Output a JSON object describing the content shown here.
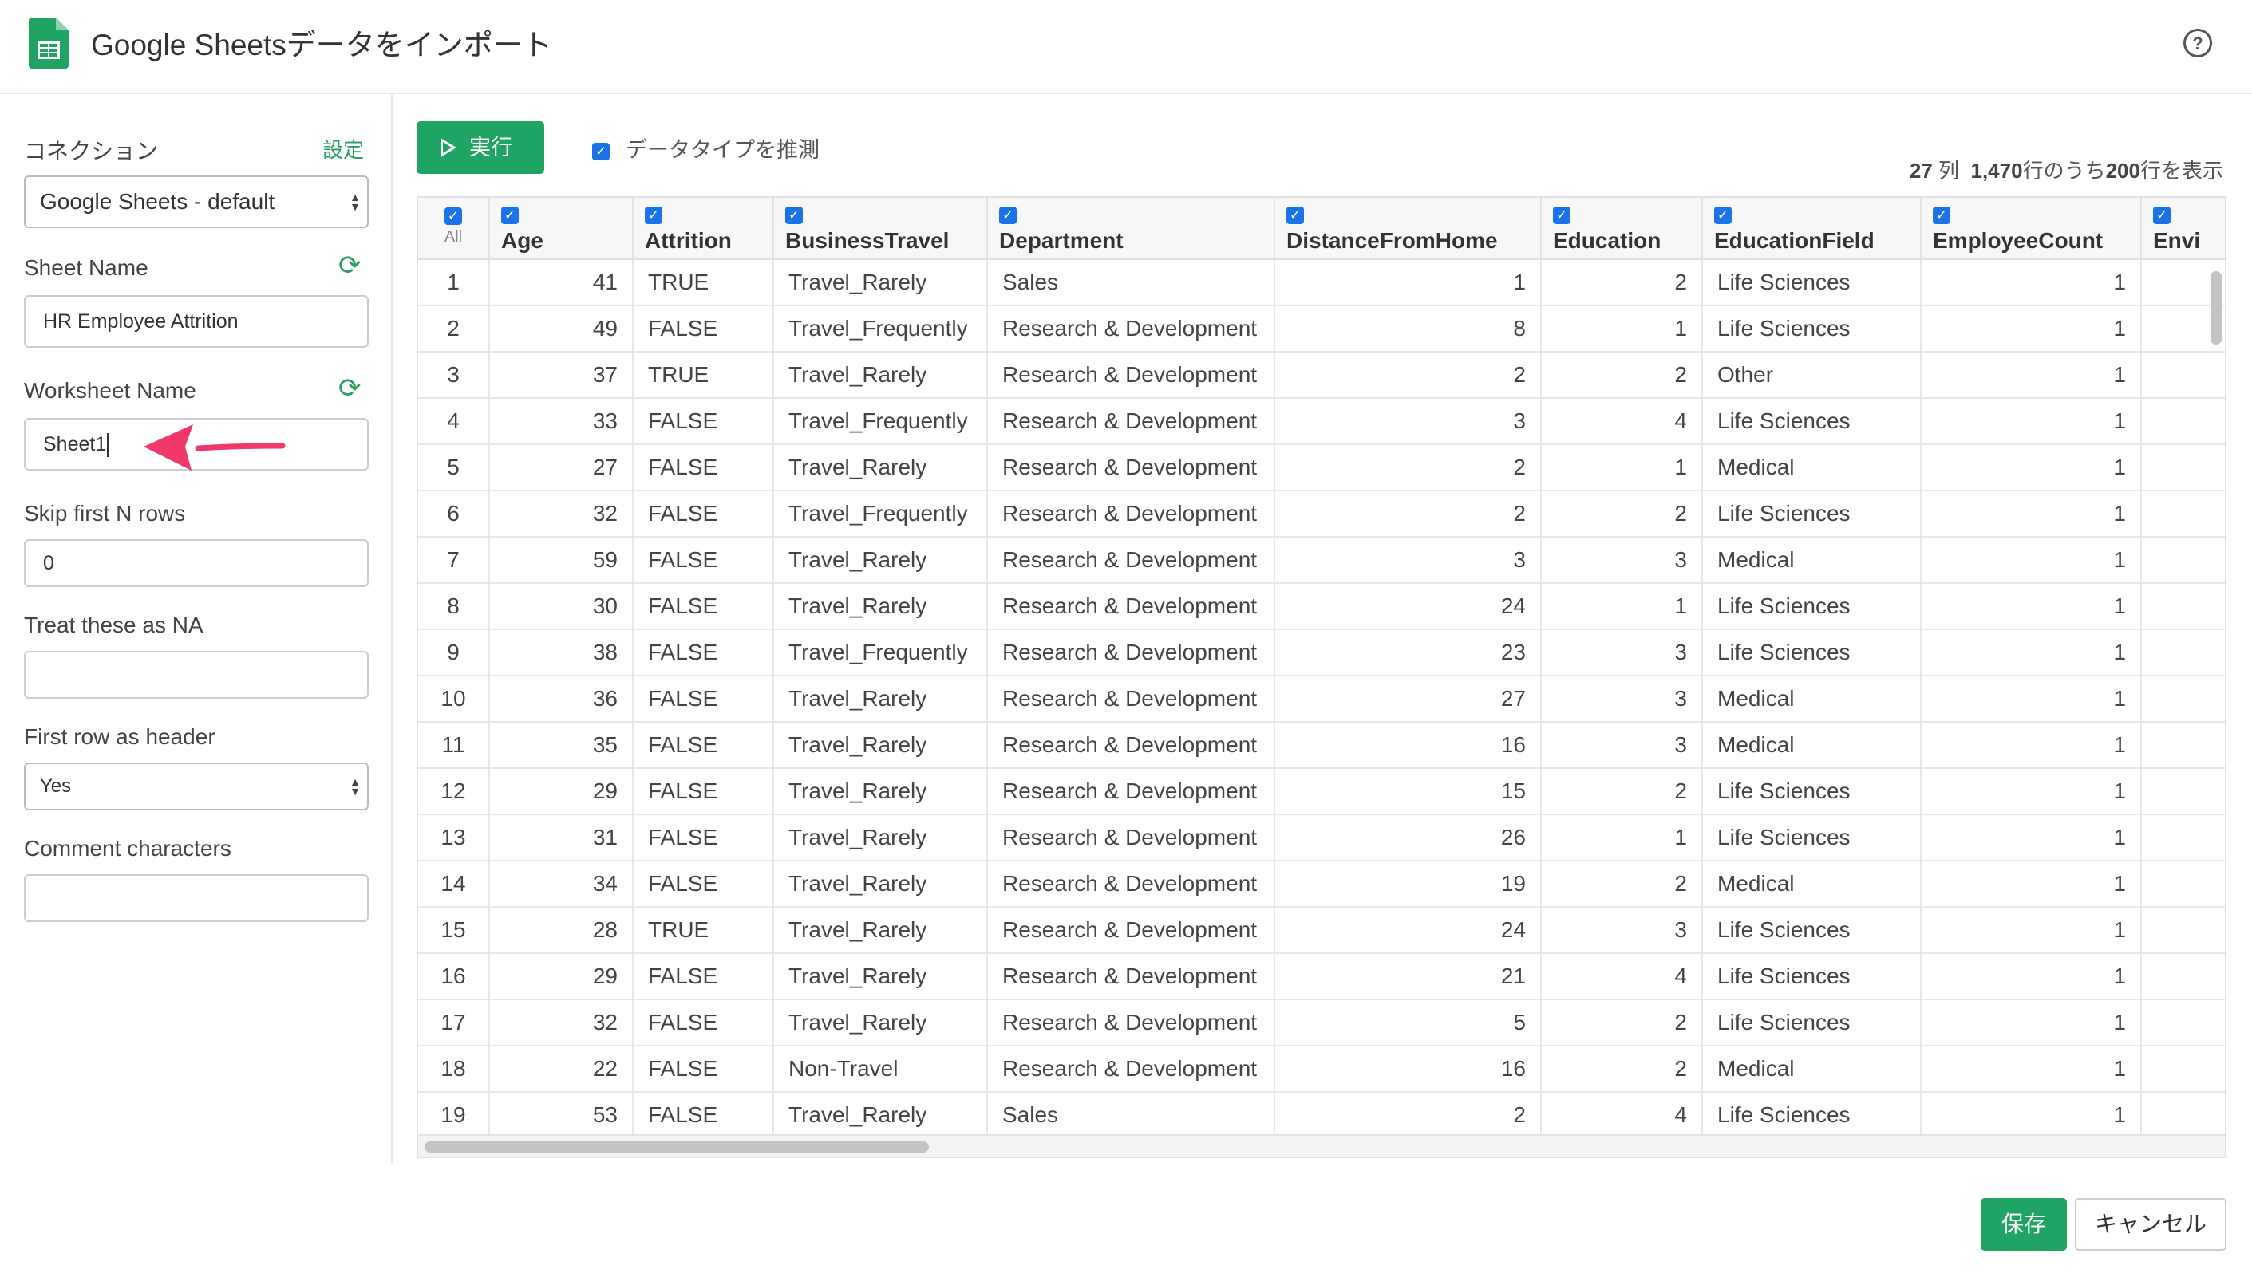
{
  "header": {
    "title": "Google Sheetsデータをインポート",
    "app_icon": "google-sheets-icon",
    "help_icon": "question-circle-icon"
  },
  "sidebar": {
    "connection_label": "コネクション",
    "connection_settings_link": "設定",
    "connection_value": "Google Sheets - default",
    "sheet_name_label": "Sheet Name",
    "sheet_name_value": "HR Employee Attrition",
    "worksheet_name_label": "Worksheet Name",
    "worksheet_name_value": "Sheet1",
    "skip_rows_label": "Skip first N rows",
    "skip_rows_value": "0",
    "na_label": "Treat these as NA",
    "na_value": "",
    "header_label": "First row as header",
    "header_value": "Yes",
    "comment_label": "Comment characters",
    "comment_value": ""
  },
  "toolbar": {
    "run_label": "実行",
    "infer_types_label": "データタイプを推測",
    "infer_types_checked": true,
    "summary": {
      "cols": "27",
      "cols_unit": "列",
      "total_rows": "1,470",
      "mid": "行のうち",
      "shown_rows": "200",
      "tail": "行を表示"
    }
  },
  "table": {
    "all_label": "All",
    "columns": [
      {
        "name": "Age",
        "type": "numeric",
        "kind": "num"
      },
      {
        "name": "Attrition",
        "type": "logical",
        "kind": "log"
      },
      {
        "name": "BusinessTravel",
        "type": "character",
        "kind": "chr"
      },
      {
        "name": "Department",
        "type": "character",
        "kind": "chr"
      },
      {
        "name": "DistanceFromHome",
        "type": "numeric",
        "kind": "num"
      },
      {
        "name": "Education",
        "type": "numeric",
        "kind": "num"
      },
      {
        "name": "EducationField",
        "type": "character",
        "kind": "chr"
      },
      {
        "name": "EmployeeCount",
        "type": "numeric",
        "kind": "num"
      },
      {
        "name": "Envi",
        "type": "nu",
        "kind": "num"
      }
    ],
    "rows": [
      [
        "1",
        "41",
        "TRUE",
        "Travel_Rarely",
        "Sales",
        "1",
        "2",
        "Life Sciences",
        "1"
      ],
      [
        "2",
        "49",
        "FALSE",
        "Travel_Frequently",
        "Research & Development",
        "8",
        "1",
        "Life Sciences",
        "1"
      ],
      [
        "3",
        "37",
        "TRUE",
        "Travel_Rarely",
        "Research & Development",
        "2",
        "2",
        "Other",
        "1"
      ],
      [
        "4",
        "33",
        "FALSE",
        "Travel_Frequently",
        "Research & Development",
        "3",
        "4",
        "Life Sciences",
        "1"
      ],
      [
        "5",
        "27",
        "FALSE",
        "Travel_Rarely",
        "Research & Development",
        "2",
        "1",
        "Medical",
        "1"
      ],
      [
        "6",
        "32",
        "FALSE",
        "Travel_Frequently",
        "Research & Development",
        "2",
        "2",
        "Life Sciences",
        "1"
      ],
      [
        "7",
        "59",
        "FALSE",
        "Travel_Rarely",
        "Research & Development",
        "3",
        "3",
        "Medical",
        "1"
      ],
      [
        "8",
        "30",
        "FALSE",
        "Travel_Rarely",
        "Research & Development",
        "24",
        "1",
        "Life Sciences",
        "1"
      ],
      [
        "9",
        "38",
        "FALSE",
        "Travel_Frequently",
        "Research & Development",
        "23",
        "3",
        "Life Sciences",
        "1"
      ],
      [
        "10",
        "36",
        "FALSE",
        "Travel_Rarely",
        "Research & Development",
        "27",
        "3",
        "Medical",
        "1"
      ],
      [
        "11",
        "35",
        "FALSE",
        "Travel_Rarely",
        "Research & Development",
        "16",
        "3",
        "Medical",
        "1"
      ],
      [
        "12",
        "29",
        "FALSE",
        "Travel_Rarely",
        "Research & Development",
        "15",
        "2",
        "Life Sciences",
        "1"
      ],
      [
        "13",
        "31",
        "FALSE",
        "Travel_Rarely",
        "Research & Development",
        "26",
        "1",
        "Life Sciences",
        "1"
      ],
      [
        "14",
        "34",
        "FALSE",
        "Travel_Rarely",
        "Research & Development",
        "19",
        "2",
        "Medical",
        "1"
      ],
      [
        "15",
        "28",
        "TRUE",
        "Travel_Rarely",
        "Research & Development",
        "24",
        "3",
        "Life Sciences",
        "1"
      ],
      [
        "16",
        "29",
        "FALSE",
        "Travel_Rarely",
        "Research & Development",
        "21",
        "4",
        "Life Sciences",
        "1"
      ],
      [
        "17",
        "32",
        "FALSE",
        "Travel_Rarely",
        "Research & Development",
        "5",
        "2",
        "Life Sciences",
        "1"
      ],
      [
        "18",
        "22",
        "FALSE",
        "Non-Travel",
        "Research & Development",
        "16",
        "2",
        "Medical",
        "1"
      ],
      [
        "19",
        "53",
        "FALSE",
        "Travel_Rarely",
        "Sales",
        "2",
        "4",
        "Life Sciences",
        "1"
      ]
    ]
  },
  "footer": {
    "save_label": "保存",
    "cancel_label": "キャンセル"
  },
  "colors": {
    "accent": "#1fa463",
    "checkbox": "#1a73e8",
    "arrow": "#f0386b"
  }
}
